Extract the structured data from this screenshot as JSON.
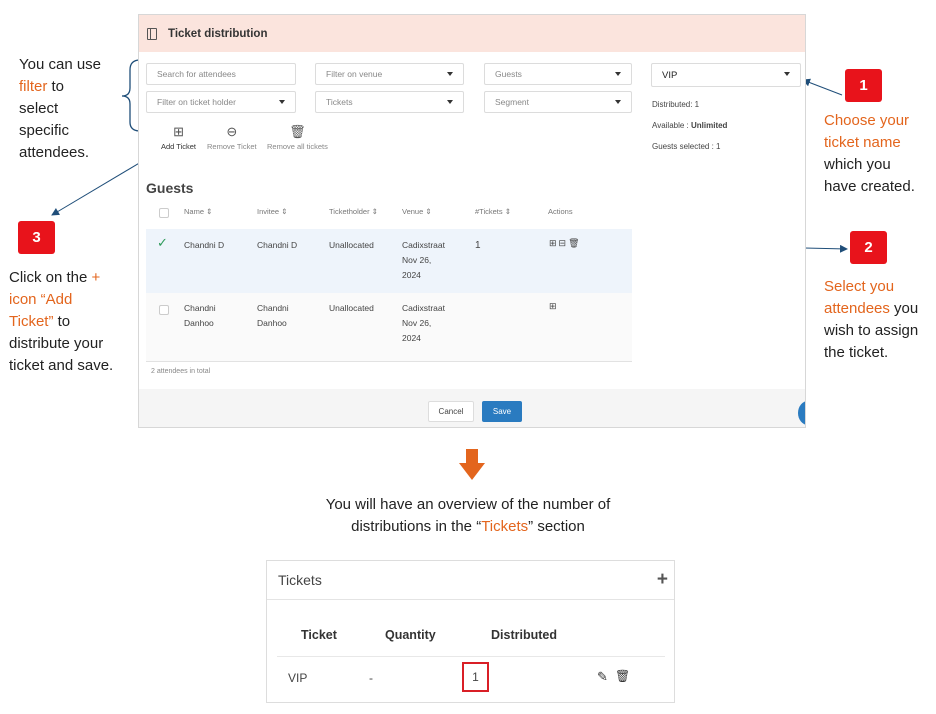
{
  "modal": {
    "title": "Ticket distribution",
    "filters": {
      "search_placeholder": "Search for attendees",
      "venue": "Filter on venue",
      "guests": "Guests",
      "ticket_holder": "Filter on ticket holder",
      "tickets": "Tickets",
      "segment": "Segment"
    },
    "ticket_select": "VIP",
    "stats": {
      "distributed": "Distributed: 1",
      "available_label": "Available :",
      "available_value": "Unlimited",
      "guests_selected": "Guests selected : 1"
    },
    "toolbar": {
      "add": "Add Ticket",
      "remove": "Remove Ticket",
      "remove_all": "Remove all tickets"
    },
    "guests_title": "Guests",
    "columns": [
      "Name",
      "Invitee",
      "Ticketholder",
      "Venue",
      "#Tickets",
      "Actions"
    ],
    "rows": [
      {
        "name": "Chandni D",
        "invitee": "Chandni D",
        "ticketholder": "Unallocated",
        "venue_l1": "Cadixstraat",
        "venue_l2": "Nov 26,",
        "venue_l3": "2024",
        "tickets": "1"
      },
      {
        "name_l1": "Chandni",
        "name_l2": "Danhoo",
        "invitee_l1": "Chandni",
        "invitee_l2": "Danhoo",
        "ticketholder": "Unallocated",
        "venue_l1": "Cadixstraat",
        "venue_l2": "Nov 26,",
        "venue_l3": "2024",
        "tickets": ""
      }
    ],
    "total": "2 attendees in total",
    "cancel": "Cancel",
    "save": "Save"
  },
  "callouts": {
    "filter": {
      "l1": "You can use",
      "l2": "filter",
      "l2b": " to",
      "l3": "select",
      "l4": "specific",
      "l5": "attendees."
    },
    "step1": {
      "num": "1",
      "l1": "Choose your",
      "l2": "ticket name",
      "l3": "which you",
      "l4": "have created."
    },
    "step2": {
      "num": "2",
      "l1": "Select you",
      "l2": "attendees",
      "l2b": " you",
      "l3": "wish to assign",
      "l4": "the ticket."
    },
    "step3": {
      "num": "3",
      "l1": "Click on the ",
      "l1b": "+",
      "l2": "icon “Add",
      "l3": "Ticket”",
      "l3b": " to",
      "l4": "distribute your",
      "l5": "ticket and save."
    },
    "overview": {
      "l1": "You will have an overview of the number of",
      "l2a": "distributions in the “",
      "l2b": "Tickets",
      "l2c": "” section"
    }
  },
  "tickets_panel": {
    "title": "Tickets",
    "columns": {
      "ticket": "Ticket",
      "quantity": "Quantity",
      "distributed": "Distributed"
    },
    "row": {
      "ticket": "VIP",
      "quantity": "-",
      "distributed": "1"
    }
  },
  "colors": {
    "accent_orange": "#e3651d",
    "badge_red": "#e8131b",
    "save_blue": "#2a7bc0",
    "header_pink": "#fbe4dd"
  }
}
